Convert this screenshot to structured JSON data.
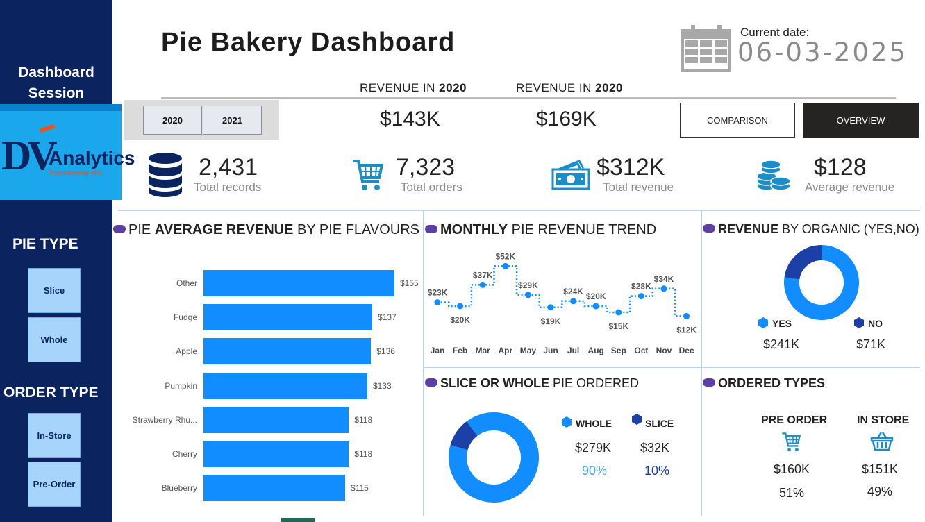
{
  "sidebar": {
    "title_line1": "Dashboard",
    "title_line2": "Session",
    "logo": {
      "text": "Analytics",
      "tagline": "Transforming You",
      "mark": "DV"
    },
    "pie_type": {
      "label": "PIE TYPE",
      "options": [
        "Slice",
        "Whole"
      ]
    },
    "order_type": {
      "label": "ORDER TYPE",
      "options": [
        "In-Store",
        "Pre-Order"
      ]
    }
  },
  "header": {
    "title": "Pie Bakery Dashboard",
    "current_date_label": "Current date:",
    "current_date_value": "06-03-2025",
    "year_buttons": [
      "2020",
      "2021"
    ],
    "revenue_a": {
      "label_prefix": "REVENUE IN",
      "year": "2020",
      "value": "$143K"
    },
    "revenue_b": {
      "label_prefix": "REVENUE IN",
      "year": "2020",
      "value": "$169K"
    },
    "comparison_label": "COMPARISON",
    "overview_label": "OVERVIEW"
  },
  "kpis": [
    {
      "value": "2,431",
      "label": "Total records",
      "icon": "database-icon"
    },
    {
      "value": "7,323",
      "label": "Total orders",
      "icon": "shopping-cart-icon"
    },
    {
      "value": "$312K",
      "label": "Total revenue",
      "icon": "cash-icon"
    },
    {
      "value": "$128",
      "label": "Average revenue",
      "icon": "coins-icon"
    }
  ],
  "colors": {
    "sidebar": "#0b2460",
    "bar": "#118dff",
    "dark_blue": "#1c3fa8",
    "light_blue": "#1aa7ec"
  },
  "panels": {
    "avg_revenue": {
      "title_pre": "PIE ",
      "title_bold": "AVERAGE REVENUE",
      "title_post": " BY PIE FLAVOURS",
      "chart_data": {
        "type": "bar",
        "orientation": "horizontal",
        "categories": [
          "Other",
          "Fudge",
          "Apple",
          "Pumpkin",
          "Strawberry Rhu...",
          "Cherry",
          "Blueberry"
        ],
        "values": [
          155,
          137,
          136,
          133,
          118,
          118,
          115
        ],
        "value_labels": [
          "$155",
          "$137",
          "$136",
          "$133",
          "$118",
          "$118",
          "$115"
        ],
        "xlim": [
          0,
          155
        ]
      }
    },
    "monthly_trend": {
      "title_bold": "MONTHLY",
      "title_post": " PIE REVENUE TREND",
      "chart_data": {
        "type": "line",
        "categories": [
          "Jan",
          "Feb",
          "Mar",
          "Apr",
          "May",
          "Jun",
          "Jul",
          "Aug",
          "Sep",
          "Oct",
          "Nov",
          "Dec"
        ],
        "values": [
          23,
          20,
          37,
          52,
          29,
          19,
          24,
          20,
          15,
          28,
          34,
          12
        ],
        "value_labels": [
          "$23K",
          "$20K",
          "$37K",
          "$52K",
          "$29K",
          "$19K",
          "$24K",
          "$20K",
          "$15K",
          "$28K",
          "$34K",
          "$12K"
        ],
        "step": true,
        "ylim": [
          0,
          55
        ]
      }
    },
    "organic": {
      "title_bold": "REVENUE",
      "title_post": " BY ORGANIC (YES,NO)",
      "chart_data": {
        "type": "pie",
        "donut": true,
        "labels": [
          "YES",
          "NO"
        ],
        "values": [
          241,
          71
        ],
        "value_labels": [
          "$241K",
          "$71K"
        ],
        "colors": [
          "#118dff",
          "#1c3fa8"
        ]
      }
    },
    "slice_whole": {
      "title_bold": "SLICE OR WHOLE",
      "title_post": " PIE ORDERED",
      "chart_data": {
        "type": "pie",
        "donut": true,
        "labels": [
          "WHOLE",
          "SLICE"
        ],
        "values": [
          279,
          32
        ],
        "value_labels": [
          "$279K",
          "$32K"
        ],
        "percents": [
          "90%",
          "10%"
        ],
        "colors": [
          "#118dff",
          "#1c3fa8"
        ]
      }
    },
    "ordered_types": {
      "title_bold": "ORDERED TYPES",
      "items": [
        {
          "label": "PRE ORDER",
          "value": "$160K",
          "percent": "51%",
          "icon": "shopping-cart-icon"
        },
        {
          "label": "IN STORE",
          "value": "$151K",
          "percent": "49%",
          "icon": "shopping-basket-icon"
        }
      ]
    }
  }
}
